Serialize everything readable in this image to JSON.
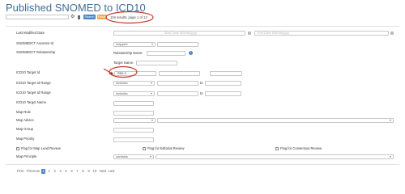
{
  "header": {
    "title": "Published SNOMED to ICD10",
    "search_placeholder": "",
    "search_button": "Search",
    "reset_button": "Reset",
    "results_text": "119 results, page 1 of 12"
  },
  "form": {
    "last_modified": {
      "label": "Last Modified Date",
      "start_placeholder": "Start Date MM/dd/yyyy",
      "end_placeholder": "End Date MM/dd/yyyy"
    },
    "ancestor": {
      "label": "SNOMEDCT Ancestor Id",
      "select_value": "mapped"
    },
    "relationship": {
      "label": "SNOMEDCT Relationship",
      "name_label": "Relationship Name:",
      "target_label": "Target Name:"
    },
    "target_id": {
      "label": "ICD10 Target Id",
      "value": "R50.9"
    },
    "target_id_range": {
      "label": "ICD10 Target Id Range",
      "select_value": "includes",
      "to_label": "to"
    },
    "target_id_range2": {
      "label": "ICD10 Target Id Range",
      "select_value": "includes",
      "to_label": "to"
    },
    "target_name": {
      "label": "ICD10 Target Name"
    },
    "map_rule": {
      "label": "Map Rule"
    },
    "map_advice": {
      "label": "Map Advice"
    },
    "map_group": {
      "label": "Map Group"
    },
    "map_priority": {
      "label": "Map Priority"
    },
    "flags": {
      "lead_review": "Flag for Map Lead Review",
      "editorial_review": "Flag for Editorial Review",
      "consensus_review": "Flag for Consensus Review"
    },
    "map_principle": {
      "label": "Map Principle",
      "select_value": "contains"
    }
  },
  "pagination": {
    "first": "First",
    "previous": "Previous",
    "pages": [
      "1",
      "2",
      "3",
      "4",
      "5",
      "6",
      "7",
      "8",
      "9",
      "10"
    ],
    "next": "Next",
    "last": "Last",
    "active_page": "1"
  },
  "colors": {
    "title": "#3e6e9a",
    "search_button": "#4b86c4",
    "reset_button": "#f0a94e",
    "annotation": "#c0392b",
    "active_page": "#4b86c4"
  },
  "icons": [
    "gear-icon",
    "trash-icon",
    "calendar-icon",
    "info-icon",
    "chevron-down-icon"
  ]
}
